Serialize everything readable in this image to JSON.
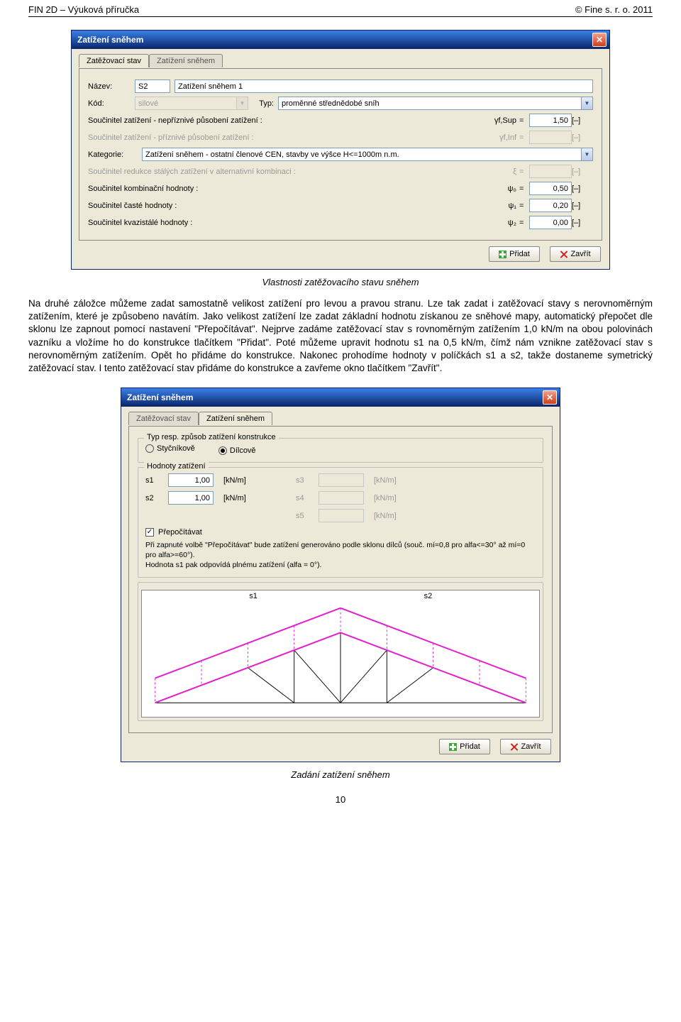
{
  "header": {
    "left": "FIN 2D – Výuková příručka",
    "right": "© Fine s. r. o. 2011"
  },
  "dialog1": {
    "title": "Zatížení sněhem",
    "tabs": [
      "Zatěžovací stav",
      "Zatížení sněhem"
    ],
    "name_lbl": "Název:",
    "name_code": "S2",
    "name_text": "Zatížení sněhem 1",
    "code_lbl": "Kód:",
    "code_val": "silové",
    "type_lbl": "Typ:",
    "type_val": "proměnné střednědobé sníh",
    "coeff1_lbl": "Součinitel zatížení - nepříznivé působení zatížení :",
    "coeff1_sym": "γf,Sup",
    "coeff1_val": "1,50",
    "coeff2_lbl": "Součinitel zatížení - příznivé působení zatížení :",
    "coeff2_sym": "γf,Inf",
    "cat_lbl": "Kategorie:",
    "cat_val": "Zatížení sněhem - ostatní členové CEN, stavby ve výšce H<=1000m n.m.",
    "coeff3_lbl": "Součinitel redukce stálých zatížení v alternativní kombinaci :",
    "coeff3_sym": "ξ",
    "coeff4_lbl": "Součinitel kombinační hodnoty :",
    "coeff4_sym": "ψ₀",
    "coeff4_val": "0,50",
    "coeff5_lbl": "Součinitel časté hodnoty :",
    "coeff5_sym": "ψ₁",
    "coeff5_val": "0,20",
    "coeff6_lbl": "Součinitel kvazistálé hodnoty :",
    "coeff6_sym": "ψ₂",
    "coeff6_val": "0,00",
    "unit": "[–]",
    "btn_add": "Přidat",
    "btn_close": "Zavřít"
  },
  "caption1": "Vlastnosti zatěžovacího stavu sněhem",
  "para": "Na druhé záložce můžeme zadat samostatně velikost zatížení pro levou a pravou stranu. Lze tak zadat i zatěžovací stavy s nerovnoměrným zatížením, které je způsobeno navátím. Jako velikost zatížení lze zadat základní hodnotu získanou ze sněhové mapy, automatický přepočet dle sklonu lze zapnout pomocí nastavení \"Přepočítávat\". Nejprve zadáme zatěžovací stav s rovnoměrným zatížením 1,0 kN/m na obou polovinách vazníku a vložíme ho do konstrukce tlačítkem \"Přidat\". Poté můžeme upravit hodnotu s1 na 0,5 kN/m, čímž nám vznikne zatěžovací stav s nerovnoměrným zatížením. Opět ho přidáme do konstrukce. Nakonec prohodíme hodnoty v políčkách s1 a s2, takže dostaneme symetrický zatěžovací stav. I tento zatěžovací stav přidáme do konstrukce a zavřeme okno tlačítkem \"Zavřít\".",
  "dialog2": {
    "title": "Zatížení sněhem",
    "tabs": [
      "Zatěžovací stav",
      "Zatížení sněhem"
    ],
    "fs1_legend": "Typ resp. způsob zatížení konstrukce",
    "radio1": "Styčníkově",
    "radio2": "Dílcově",
    "fs2_legend": "Hodnoty zatížení",
    "s1": "s1",
    "s2": "s2",
    "s3": "s3",
    "s4": "s4",
    "s5": "s5",
    "v1": "1,00",
    "v2": "1,00",
    "unit": "[kN/m]",
    "recalc": "Přepočítávat",
    "note": "Při zapnuté volbě \"Přepočítávat\" bude zatížení generováno podle sklonu dílců (souč. mí=0,8 pro alfa<=30° až mí=0 pro alfa>=60°).\nHodnota s1 pak odpovídá plnému zatížení (alfa = 0°).",
    "gl1": "s1",
    "gl2": "s2",
    "btn_add": "Přidat",
    "btn_close": "Zavřít"
  },
  "caption2": "Zadání zatížení sněhem",
  "pgnum": "10"
}
